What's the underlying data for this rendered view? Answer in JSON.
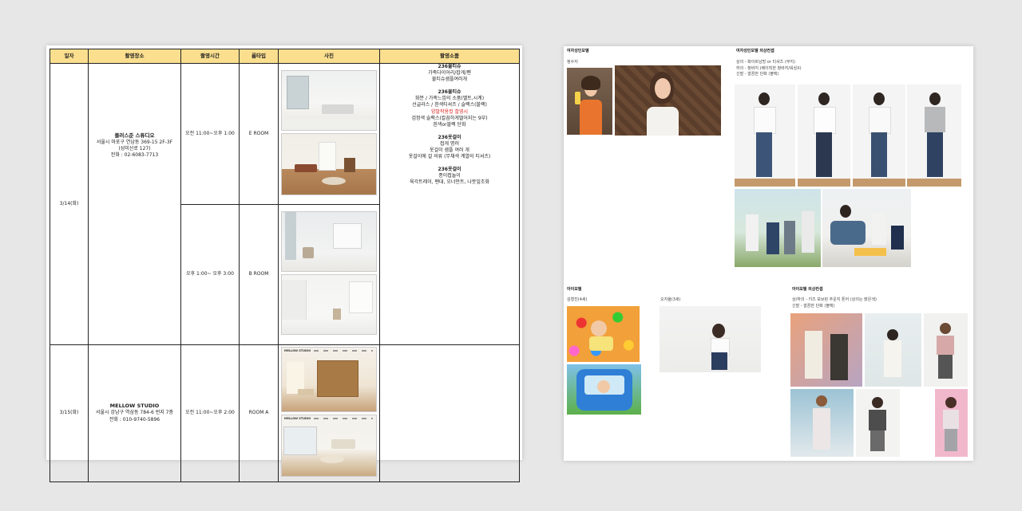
{
  "left_page": {
    "headers": [
      "일자",
      "촬영장소",
      "촬영시간",
      "룸타입",
      "사진",
      "촬영소품"
    ],
    "rows": [
      {
        "date": "3/14(화)",
        "venue_name": "플러스준 스튜디오",
        "venue_address": "서울시 마포구 연남동 369-15 2F-3F",
        "venue_address_2": "(성미산로 127)",
        "venue_phone": "전화 : 02-6083-7713",
        "sessions": [
          {
            "time": "오전 11:00~오후 1:00",
            "room": "E ROOM"
          },
          {
            "time": "오후 1:00~ 오후 3:00",
            "room": "B ROOM"
          }
        ]
      },
      {
        "date": "3/15(화)",
        "venue_name": "MELLOW STUDIO",
        "venue_address": "서울시 강남구 역삼동 784-6 번지 7층",
        "venue_phone": "전화 : 010-9740-5896",
        "sessions": [
          {
            "time": "오전 11:00~오후 2:00",
            "room": "ROOM A"
          }
        ]
      }
    ],
    "notes": [
      {
        "title": "236물티슈",
        "lines": [
          "가족다이어리/잡게/펜",
          "물티슈샘플여러개"
        ]
      },
      {
        "title": "236물티슈",
        "lines": [
          "화분 / 가족느낌의 소품(벨트,시계)",
          "선글라스 / 흰색티셔츠 / 슬랙스(블랙)"
        ],
        "red_line": "양말착용컷 촬영시",
        "lines_after": [
          "검정색 슬랙스(칼끔하게떨어지는 9부)",
          "흰색or블랙 단화"
        ]
      },
      {
        "title": "236옷걸이",
        "lines": [
          "접게 명러",
          "옷걸이 샘플 여러 개",
          "옷걸이에 걸 의류 (무채색 계열의 티셔츠)"
        ]
      },
      {
        "title": "236옷걸이",
        "lines": [
          "종이접놀이",
          "육각트레이, 펜대, 오너먼트, 나뭇잎조화"
        ]
      }
    ]
  },
  "right_page": {
    "sections": {
      "female_model": {
        "title": "여자성인모델",
        "name": "정수지"
      },
      "female_outfit": {
        "title": "여자성인모델 의상컨셉",
        "lines": [
          "상의 - 화이트남방 or 티셔츠 (무지)",
          "하의 - 청바지 (베이직한 청바지/워싱X)",
          "신발 - 깔끔한 단화 (블랙)"
        ]
      },
      "kid_model": {
        "title": "아이모델",
        "names": [
          "김형진(4세)",
          "오지율(3세)"
        ]
      },
      "kid_outfit": {
        "title": "아이모델 의상컨셉",
        "lines": [
          "상/하의 - 키즈 모브된 추운지 톤어 (상의는 밝은색)",
          "신발 - 깔끔한 단화 (블랙)"
        ]
      }
    },
    "browser_nav": {
      "brand": "MELLOW STUDIO"
    }
  }
}
